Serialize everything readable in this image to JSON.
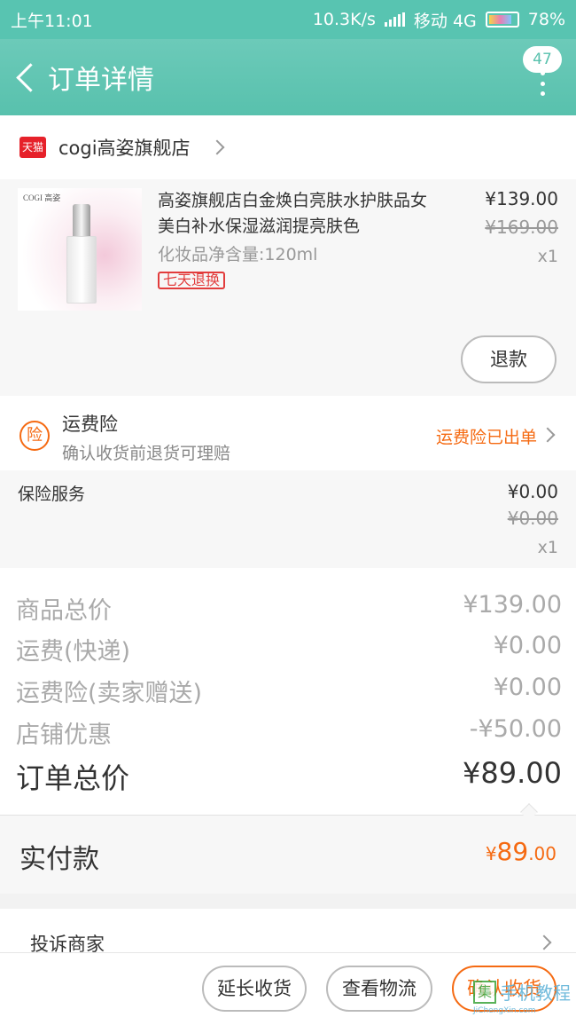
{
  "status_bar": {
    "time": "上午11:01",
    "speed": "10.3K/s",
    "carrier": "移动 4G",
    "battery": "78%"
  },
  "nav": {
    "title": "订单详情",
    "badge": "47"
  },
  "shop": {
    "badge": "天猫",
    "name": "cogi高姿旗舰店"
  },
  "product": {
    "brand": "COGI 高姿",
    "title": "高姿旗舰店白金焕白亮肤水护肤品女 美白补水保湿滋润提亮肤色",
    "spec": "化妆品净含量:120ml",
    "tag": "七天退换",
    "price": "¥139.00",
    "original_price": "¥169.00",
    "quantity": "x1",
    "refund_label": "退款"
  },
  "insurance": {
    "icon_label": "险",
    "title": "运费险",
    "subtitle": "确认收货前退货可理赔",
    "status": "运费险已出单"
  },
  "service": {
    "name": "保险服务",
    "price": "¥0.00",
    "original_price": "¥0.00",
    "quantity": "x1"
  },
  "summary": {
    "rows": [
      {
        "label": "商品总价",
        "value": "¥139.00"
      },
      {
        "label": "运费(快递)",
        "value": "¥0.00"
      },
      {
        "label": "运费险(卖家赠送)",
        "value": "¥0.00"
      },
      {
        "label": "店铺优惠",
        "value": "-¥50.00"
      }
    ],
    "total_label": "订单总价",
    "total_value": "¥89.00"
  },
  "paid": {
    "label": "实付款",
    "symbol": "¥",
    "integer": "89",
    "decimal": ".00"
  },
  "complain": {
    "label": "投诉商家"
  },
  "actions": {
    "extend": "延长收货",
    "track": "查看物流",
    "confirm": "确认收货"
  },
  "watermark": {
    "box": "集",
    "text": "手机教程",
    "url": "JiChengXin.com"
  },
  "colors": {
    "header": "#58c1ad",
    "accent": "#f56a12",
    "tmall": "#e6212a"
  }
}
